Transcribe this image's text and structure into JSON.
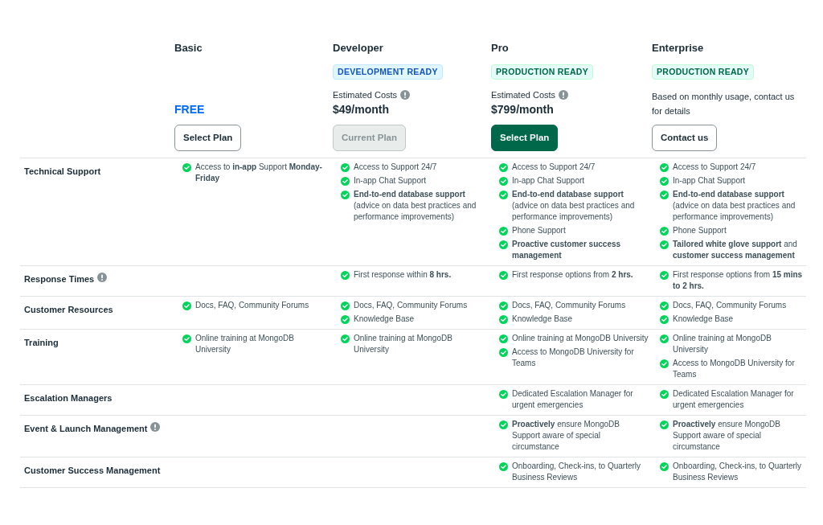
{
  "plans": [
    {
      "name": "Basic",
      "price": "FREE",
      "price_highlight": true,
      "button": {
        "label": "Select Plan",
        "kind": "outline"
      }
    },
    {
      "name": "Developer",
      "badge": {
        "text": "DEVELOPMENT READY",
        "kind": "development"
      },
      "cost_label": "Estimated Costs",
      "price": "$49/month",
      "price_highlight": false,
      "button": {
        "label": "Current Plan",
        "kind": "disabled"
      }
    },
    {
      "name": "Pro",
      "badge": {
        "text": "PRODUCTION READY",
        "kind": "production"
      },
      "cost_label": "Estimated Costs",
      "price": "$799/month",
      "price_highlight": false,
      "button": {
        "label": "Select Plan",
        "kind": "primary"
      }
    },
    {
      "name": "Enterprise",
      "badge": {
        "text": "PRODUCTION READY",
        "kind": "production"
      },
      "note": "Based on monthly usage, contact us for details",
      "button": {
        "label": "Contact us",
        "kind": "outline"
      }
    }
  ],
  "rows": [
    {
      "label": "Technical Support",
      "info": false,
      "cells": [
        [
          "Access to **in-app** Support **Monday-Friday**"
        ],
        [
          "Access to Support 24/7",
          "In-app Chat Support",
          "**End-to-end database support** (advice on data best practices and performance improvements)"
        ],
        [
          "Access to Support 24/7",
          "In-app Chat Support",
          "**End-to-end database support** (advice on data best practices and performance improvements)",
          "Phone Support",
          "**Proactive customer success management**"
        ],
        [
          "Access to Support 24/7",
          "In-app Chat Support",
          "**End-to-end database support** (advice on data best practices and performance improvements)",
          "Phone Support",
          "**Tailored white glove support** and **customer success management**"
        ]
      ]
    },
    {
      "label": "Response Times",
      "info": true,
      "cells": [
        [],
        [
          "First response within **8 hrs.**"
        ],
        [
          "First response options from **2 hrs.**"
        ],
        [
          "First response options from **15 mins to 2 hrs.**"
        ]
      ]
    },
    {
      "label": "Customer Resources",
      "info": false,
      "cells": [
        [
          "Docs, FAQ, Community Forums"
        ],
        [
          "Docs, FAQ, Community Forums",
          "Knowledge Base"
        ],
        [
          "Docs, FAQ, Community Forums",
          "Knowledge Base"
        ],
        [
          "Docs, FAQ, Community Forums",
          "Knowledge Base"
        ]
      ]
    },
    {
      "label": "Training",
      "info": false,
      "cells": [
        [
          "Online training at MongoDB University"
        ],
        [
          "Online training at MongoDB University"
        ],
        [
          "Online training at MongoDB University",
          "Access to MongoDB University for Teams"
        ],
        [
          "Online training at MongoDB University",
          "Access to MongoDB University for Teams"
        ]
      ]
    },
    {
      "label": "Escalation Managers",
      "info": false,
      "cells": [
        [],
        [],
        [
          "Dedicated Escalation Manager for urgent emergencies"
        ],
        [
          "Dedicated Escalation Manager for urgent emergencies"
        ]
      ]
    },
    {
      "label": "Event & Launch Management",
      "info": true,
      "cells": [
        [],
        [],
        [
          "**Proactively** ensure MongoDB Support aware of special circumstance"
        ],
        [
          "**Proactively** ensure MongoDB Support aware of special circumstance"
        ]
      ]
    },
    {
      "label": "Customer Success Management",
      "info": false,
      "cells": [
        [],
        [],
        [
          "Onboarding, Check-ins, to Quarterly Business Reviews"
        ],
        [
          "Onboarding, Check-ins, to Quarterly Business Reviews"
        ]
      ]
    }
  ]
}
